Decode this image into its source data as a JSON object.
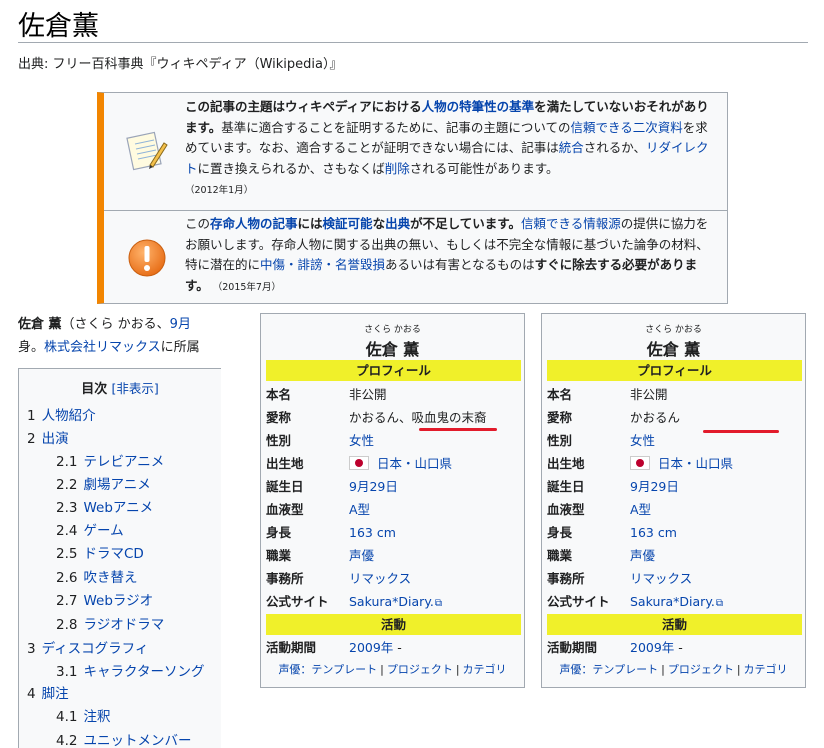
{
  "title": "佐倉薫",
  "source_prefix": "出典: フリー百科事典『ウィキペディア（Wikipedia）』",
  "notice1": {
    "bold1": "この記事の主題はウィキペディアにおける",
    "link1": "人物の特筆性の基準",
    "bold2": "を満たしていないおそれがあります。",
    "t1": "基準に適合することを証明するために、記事の主題についての",
    "link2": "信頼できる二次資料",
    "t2": "を求めています。なお、適合することが証明できない場合には、記事は",
    "link3": "統合",
    "t3": "されるか、",
    "link4": "リダイレクト",
    "t4": "に置き換えられるか、さもなくば",
    "link5": "削除",
    "t5": "される可能性があります。",
    "date": "（2012年1月）"
  },
  "notice2": {
    "b1": "この",
    "l1": "存命人物の記事",
    "b2": "には",
    "l2": "検証可能",
    "b3": "な",
    "l3": "出典",
    "b4": "が不足しています。",
    "l4": "信頼できる情報源",
    "t1": "の提供に協力をお願いします。存命人物に関する出典の無い、もしくは不完全な情報に基づいた論争の材料、特に潜在的に",
    "l5": "中傷・誹謗・名誉毀損",
    "t2": "あるいは有害となるものは",
    "b5": "すぐに除去する必要があります。",
    "date": "（2015年7月）"
  },
  "lead": {
    "name": "佐倉 薫",
    "t1": "（さくら かおる、",
    "l1": "9月",
    "t2": "身。",
    "l2": "株式会社リマックス",
    "t3": "に所属"
  },
  "toc": {
    "title": "目次",
    "toggle": "[非表示]",
    "items": [
      {
        "num": "1",
        "label": "人物紹介"
      },
      {
        "num": "2",
        "label": "出演"
      },
      {
        "num": "2.1",
        "label": "テレビアニメ"
      },
      {
        "num": "2.2",
        "label": "劇場アニメ"
      },
      {
        "num": "2.3",
        "label": "Webアニメ"
      },
      {
        "num": "2.4",
        "label": "ゲーム"
      },
      {
        "num": "2.5",
        "label": "ドラマCD"
      },
      {
        "num": "2.6",
        "label": "吹き替え"
      },
      {
        "num": "2.7",
        "label": "Webラジオ"
      },
      {
        "num": "2.8",
        "label": "ラジオドラマ"
      },
      {
        "num": "3",
        "label": "ディスコグラフィ"
      },
      {
        "num": "3.1",
        "label": "キャラクターソング"
      },
      {
        "num": "4",
        "label": "脚注"
      },
      {
        "num": "4.1",
        "label": "注釈"
      },
      {
        "num": "4.2",
        "label": "ユニットメンバー"
      }
    ]
  },
  "infobox_left": {
    "ruby": "さくら かおる",
    "name": "佐倉 薫",
    "header_profile": "プロフィール",
    "header_activity": "活動",
    "rows": [
      {
        "k": "本名",
        "v": "非公開"
      },
      {
        "k": "愛称",
        "v": "かおるん、吸血鬼の末裔"
      },
      {
        "k": "性別",
        "v": "女性"
      },
      {
        "k": "出生地",
        "v": "日本・山口県"
      },
      {
        "k": "誕生日",
        "v": "9月29日"
      },
      {
        "k": "血液型",
        "v": "A型"
      },
      {
        "k": "身長",
        "v": "163 cm"
      },
      {
        "k": "職業",
        "v": "声優"
      },
      {
        "k": "事務所",
        "v": "リマックス"
      },
      {
        "k": "公式サイト",
        "v": "Sakura*Diary."
      }
    ],
    "activity_row": {
      "k": "活動期間",
      "v": "2009年",
      "suffix": " -"
    },
    "footer": {
      "a": "声優：テンプレート",
      "b": "プロジェクト",
      "c": "カテゴリ"
    }
  },
  "infobox_right": {
    "ruby": "さくら かおる",
    "name": "佐倉 薫",
    "header_profile": "プロフィール",
    "header_activity": "活動",
    "rows": [
      {
        "k": "本名",
        "v": "非公開"
      },
      {
        "k": "愛称",
        "v": "かおるん"
      },
      {
        "k": "性別",
        "v": "女性"
      },
      {
        "k": "出生地",
        "v": "日本・山口県"
      },
      {
        "k": "誕生日",
        "v": "9月29日"
      },
      {
        "k": "血液型",
        "v": "A型"
      },
      {
        "k": "身長",
        "v": "163 cm"
      },
      {
        "k": "職業",
        "v": "声優"
      },
      {
        "k": "事務所",
        "v": "リマックス"
      },
      {
        "k": "公式サイト",
        "v": "Sakura*Diary."
      }
    ],
    "activity_row": {
      "k": "活動期間",
      "v": "2009年",
      "suffix": " -"
    },
    "footer": {
      "a": "声優：テンプレート",
      "b": "プロジェクト",
      "c": "カテゴリ"
    }
  },
  "colors": {
    "accent_orange": "#f28500",
    "header_yellow": "#f0f02a",
    "link_blue": "#0645ad",
    "annotation_red": "#e21b2b"
  }
}
